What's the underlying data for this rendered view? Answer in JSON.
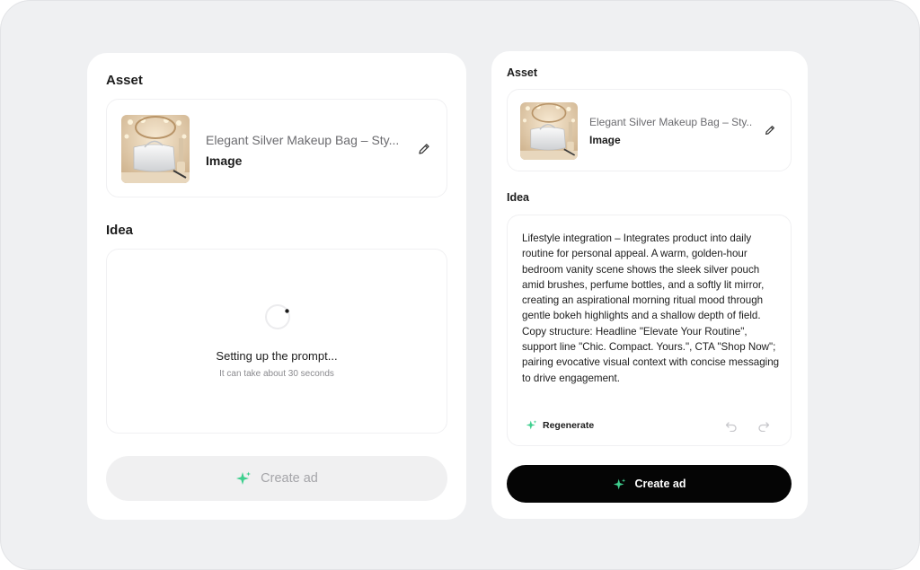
{
  "left_panel": {
    "asset_title": "Asset",
    "asset": {
      "name": "Elegant Silver Makeup Bag – Sty...",
      "type": "Image"
    },
    "idea_title": "Idea",
    "loading": {
      "title": "Setting up the prompt...",
      "subtitle": "It can take about 30 seconds"
    },
    "create_label": "Create ad"
  },
  "right_panel": {
    "asset_title": "Asset",
    "asset": {
      "name": "Elegant Silver Makeup Bag – Sty...",
      "type": "Image"
    },
    "idea_title": "Idea",
    "idea_text": "Lifestyle integration – Integrates product into daily routine for personal appeal. A warm, golden-hour bedroom vanity scene shows the sleek silver pouch amid brushes, perfume bottles, and a softly lit mirror, creating an aspirational morning ritual mood through gentle bokeh highlights and a shallow depth of field. Copy structure: Headline \"Elevate Your Routine\", support line \"Chic. Compact. Yours.\", CTA \"Shop Now\"; pairing evocative visual context with concise messaging to drive engagement.",
    "regenerate_label": "Regenerate",
    "create_label": "Create ad"
  },
  "icons": {
    "sparkle": "sparkle-icon",
    "edit": "pencil-icon",
    "undo": "undo-icon",
    "redo": "redo-icon",
    "spinner": "spinner-icon"
  },
  "colors": {
    "sparkle_green": "#3ecf8e",
    "button_dark": "#050505",
    "button_disabled": "#f0f0f1",
    "text_muted": "#6b6b6f"
  }
}
